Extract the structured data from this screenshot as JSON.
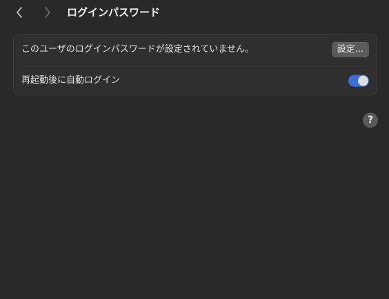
{
  "toolbar": {
    "title": "ログインパスワード",
    "back_icon": "chevron-left-icon",
    "forward_icon": "chevron-right-icon"
  },
  "settings": {
    "password_row": {
      "label": "このユーザのログインパスワードが設定されていません。",
      "button_label": "設定..."
    },
    "auto_login_row": {
      "label": "再起動後に自動ログイン",
      "toggle_on": true
    }
  },
  "help": {
    "label": "?"
  },
  "colors": {
    "background": "#292929",
    "group_background": "#2f2f2f",
    "toggle_accent": "#3e6fd8",
    "button_background": "#5b5b5b"
  }
}
